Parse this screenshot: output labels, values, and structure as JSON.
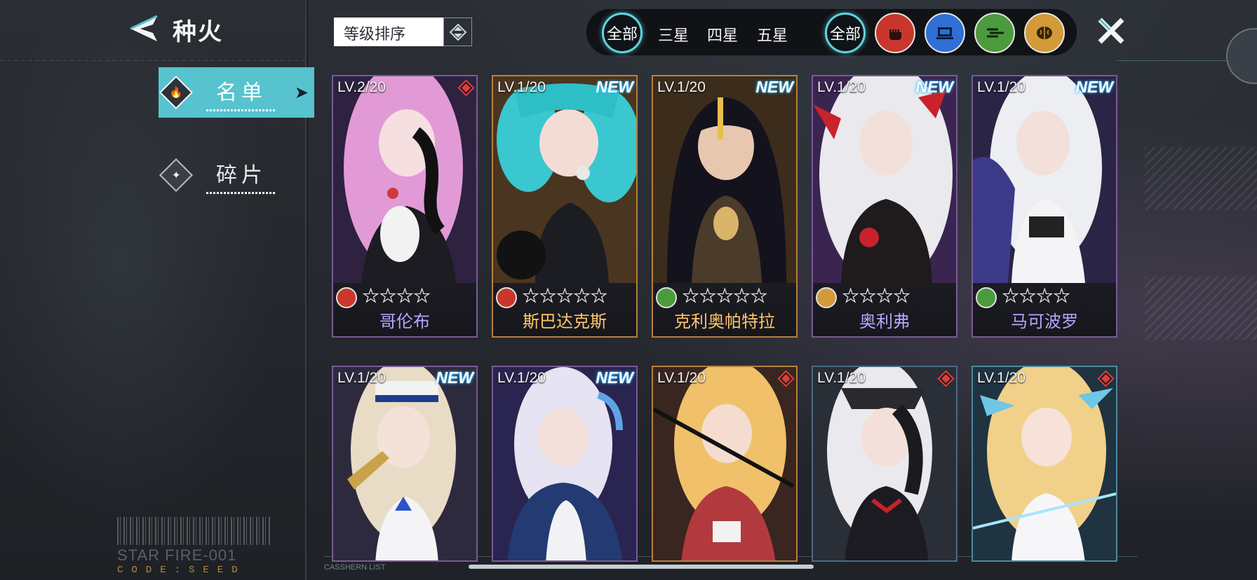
{
  "header": {
    "title": "种火"
  },
  "nav": {
    "items": [
      {
        "label": "名单",
        "active": true
      },
      {
        "label": "碎片",
        "active": false
      }
    ]
  },
  "sort": {
    "label": "等级排序"
  },
  "filters": {
    "rarity": [
      "全部",
      "三星",
      "四星",
      "五星"
    ],
    "attribute_all": "全部",
    "attribute_icons": [
      "fist-icon",
      "computer-icon",
      "wind-lines-icon",
      "brain-icon"
    ]
  },
  "colors": {
    "accent": "#56c3cf",
    "attr_fist": "#c9372c",
    "attr_tech": "#2f6fd6",
    "attr_wind": "#4c9a3e",
    "attr_brain": "#d39a3a"
  },
  "cards": [
    {
      "level": "LV.2/20",
      "name": "哥伦布",
      "new": "",
      "stars": "★★★★",
      "attr": "fist"
    },
    {
      "level": "LV.1/20",
      "name": "斯巴达克斯",
      "new": "NEW",
      "stars": "★★★★★",
      "attr": "fist"
    },
    {
      "level": "LV.1/20",
      "name": "克利奥帕特拉",
      "new": "NEW",
      "stars": "★★★★★",
      "attr": "wind"
    },
    {
      "level": "LV.1/20",
      "name": "奥利弗",
      "new": "NEW",
      "stars": "★★★★",
      "attr": "brain"
    },
    {
      "level": "LV.1/20",
      "name": "马可波罗",
      "new": "NEW",
      "stars": "★★★★",
      "attr": "wind"
    },
    {
      "level": "LV.1/20",
      "new": "NEW"
    },
    {
      "level": "LV.1/20",
      "new": "NEW"
    },
    {
      "level": "LV.1/20",
      "new": ""
    },
    {
      "level": "LV.1/20",
      "new": ""
    },
    {
      "level": "LV.1/20",
      "new": ""
    }
  ],
  "footer": {
    "barcode_text": "STAR FIRE-001",
    "code_text": "CODE:SEED",
    "list_tag": "CASSHERN LIST"
  }
}
